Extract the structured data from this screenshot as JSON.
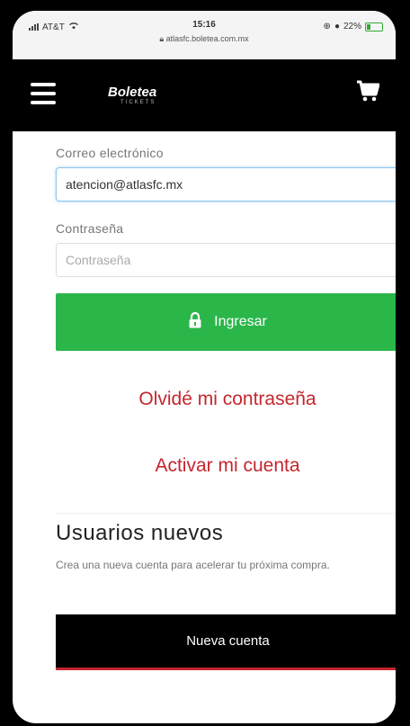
{
  "status_bar": {
    "carrier": "AT&T",
    "time": "15:16",
    "url": "atlasfc.boletea.com.mx",
    "battery": "22%"
  },
  "navbar": {
    "logo_text": "Boletea",
    "logo_sub": "TICKETS"
  },
  "login": {
    "email_label": "Correo electrónico",
    "email_value": "atencion@atlasfc.mx",
    "password_label": "Contraseña",
    "password_placeholder": "Contraseña",
    "login_button": "Ingresar",
    "forgot_link": "Olvidé mi contraseña",
    "activate_link": "Activar mi cuenta"
  },
  "new_users": {
    "title": "Usuarios nuevos",
    "description": "Crea una nueva cuenta para acelerar tu próxima compra.",
    "button": "Nueva cuenta"
  },
  "colors": {
    "primary_green": "#2bb64a",
    "link_red": "#c4262e",
    "navbar_bg": "#000000"
  }
}
